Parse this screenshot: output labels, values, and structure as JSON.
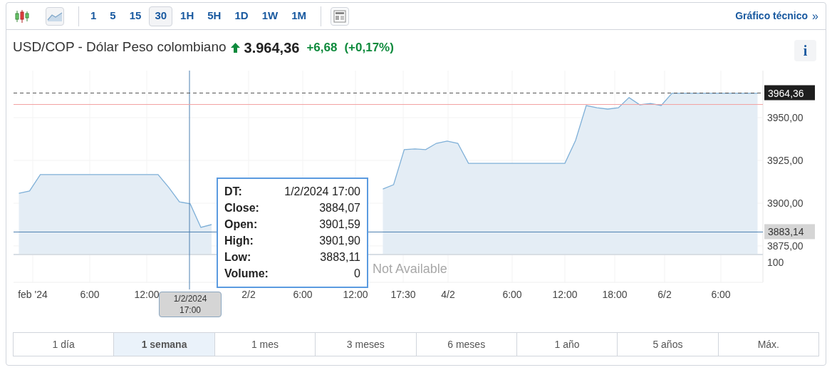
{
  "toolbar": {
    "chart_types": [
      {
        "kind": "candlestick",
        "selected": false
      },
      {
        "kind": "line",
        "selected": true
      }
    ],
    "intervals": [
      {
        "label": "1",
        "selected": false
      },
      {
        "label": "5",
        "selected": false
      },
      {
        "label": "15",
        "selected": false
      },
      {
        "label": "30",
        "selected": true
      },
      {
        "label": "1H",
        "selected": false
      },
      {
        "label": "5H",
        "selected": false
      },
      {
        "label": "1D",
        "selected": false
      },
      {
        "label": "1W",
        "selected": false
      },
      {
        "label": "1M",
        "selected": false
      }
    ],
    "link": "Gráfico técnico",
    "link_icon": "»"
  },
  "header": {
    "symbol": "USD/COP - Dólar Peso colombiano",
    "price": "3.964,36",
    "change": "+6,68",
    "change_pct": "(+0,17%)",
    "info": "i"
  },
  "chart": {
    "chart_data": {
      "type": "area",
      "grid": true,
      "ylim": [
        3870.4,
        3977.5
      ],
      "yticks": [
        {
          "value": 3950,
          "label": "3950,00"
        },
        {
          "value": 3925,
          "label": "3925,00"
        },
        {
          "value": 3900,
          "label": "3900,00"
        },
        {
          "value": 3875,
          "label": "3875,00"
        }
      ],
      "series": [
        {
          "color": "#7fb0d8",
          "values": [
            3905.8,
            3907.1,
            3916.7,
            3916.7,
            3916.7,
            3916.7,
            3916.7,
            3916.7,
            3916.7,
            3916.7,
            3916.7,
            3916.7,
            3916.7,
            3916.7,
            3909.2,
            3900.8,
            3899.6,
            3885.8,
            3887.5,
            null,
            null,
            null,
            null,
            null,
            null,
            null,
            null,
            null,
            null,
            null,
            null,
            null,
            null,
            null,
            3908.3,
            3910.8,
            3931.3,
            3931.7,
            3931.3,
            3935,
            3936.3,
            3935,
            3923.3,
            3923.3,
            3923.3,
            3923.3,
            3923.3,
            3923.3,
            3923.3,
            3923.3,
            3923.3,
            3923.3,
            3936.7,
            3957.1,
            3955.8,
            3955,
            3955.8,
            3961.7,
            3957.5,
            3958.3,
            3957.1,
            3964.2,
            3964.2,
            3964.2,
            3964.2,
            3964.2,
            3964.2,
            3964.2,
            3964.2,
            3964.2
          ]
        }
      ],
      "ref_lines": [
        {
          "axis": "y",
          "value": 3964.36,
          "label": "3964,36"
        },
        {
          "axis": "y",
          "value": 3957.68
        },
        {
          "axis": "y",
          "value": 3883.14,
          "label": "3883,14"
        }
      ]
    },
    "x_axis_labels": [
      "feb '24",
      "6:00",
      "12:00",
      "2/2",
      "6:00",
      "12:00",
      "17:30",
      "4/2",
      "6:00",
      "12:00",
      "18:00",
      "6/2",
      "6:00"
    ],
    "volume_axis_label": "100",
    "volume_message": "Not Available",
    "cursor_date": "1/2/2024",
    "cursor_time": "17:00",
    "tooltip": [
      {
        "label": "DT:",
        "value": "1/2/2024 17:00"
      },
      {
        "label": "Close:",
        "value": "3884,07"
      },
      {
        "label": "Open:",
        "value": "3901,59"
      },
      {
        "label": "High:",
        "value": "3901,90"
      },
      {
        "label": "Low:",
        "value": "3883,11"
      },
      {
        "label": "Volume:",
        "value": "0"
      }
    ]
  },
  "ranges": [
    {
      "label": "1 día",
      "selected": false
    },
    {
      "label": "1 semana",
      "selected": true
    },
    {
      "label": "1 mes",
      "selected": false
    },
    {
      "label": "3 meses",
      "selected": false
    },
    {
      "label": "6 meses",
      "selected": false
    },
    {
      "label": "1 año",
      "selected": false
    },
    {
      "label": "5 años",
      "selected": false
    },
    {
      "label": "Máx.",
      "selected": false
    }
  ]
}
